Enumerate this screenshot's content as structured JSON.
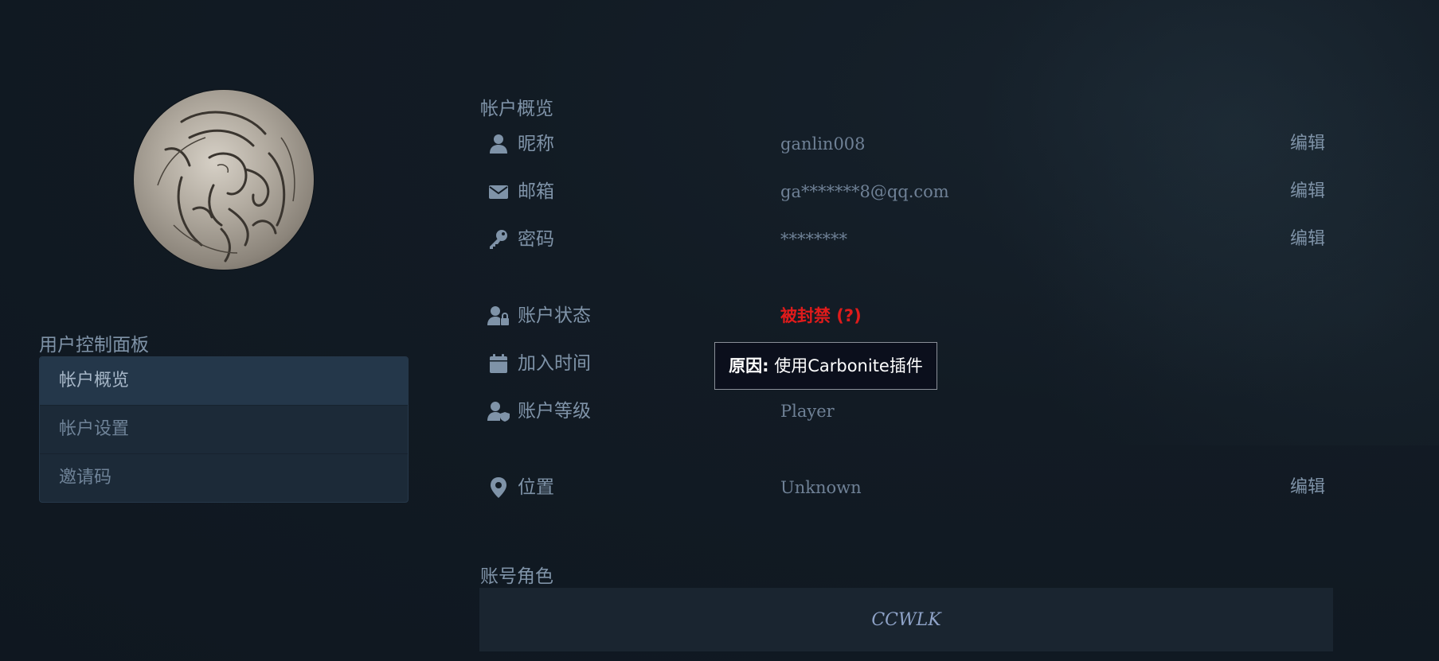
{
  "sidebar": {
    "panel_title": "用户控制面板",
    "items": [
      {
        "label": "帐户概览",
        "active": true
      },
      {
        "label": "帐户设置",
        "active": false
      },
      {
        "label": "邀请码",
        "active": false
      }
    ]
  },
  "overview": {
    "title": "帐户概览",
    "rows": {
      "nickname": {
        "icon": "user-icon",
        "label": "昵称",
        "value": "ganlin008",
        "edit": "编辑"
      },
      "email": {
        "icon": "envelope-icon",
        "label": "邮箱",
        "value": "ga*******8@qq.com",
        "edit": "编辑"
      },
      "password": {
        "icon": "key-icon",
        "label": "密码",
        "value": "********",
        "edit": "编辑"
      },
      "status": {
        "icon": "user-lock-icon",
        "label": "账户状态",
        "value": "被封禁 (?)"
      },
      "joined": {
        "icon": "calendar-icon",
        "label": "加入时间",
        "value": ""
      },
      "level": {
        "icon": "user-shield-icon",
        "label": "账户等级",
        "value": "Player"
      },
      "location": {
        "icon": "map-marker-icon",
        "label": "位置",
        "value": "Unknown",
        "edit": "编辑"
      }
    }
  },
  "tooltip": {
    "prefix": "原因:",
    "text": " 使用Carbonite插件"
  },
  "roles": {
    "title": "账号角色",
    "items": [
      "CCWLK"
    ]
  },
  "colors": {
    "background": "#121b24",
    "text": "#7f93a8",
    "banned": "#e01b1b",
    "active_menu": "#24374a",
    "role": "#8fa3c8"
  }
}
